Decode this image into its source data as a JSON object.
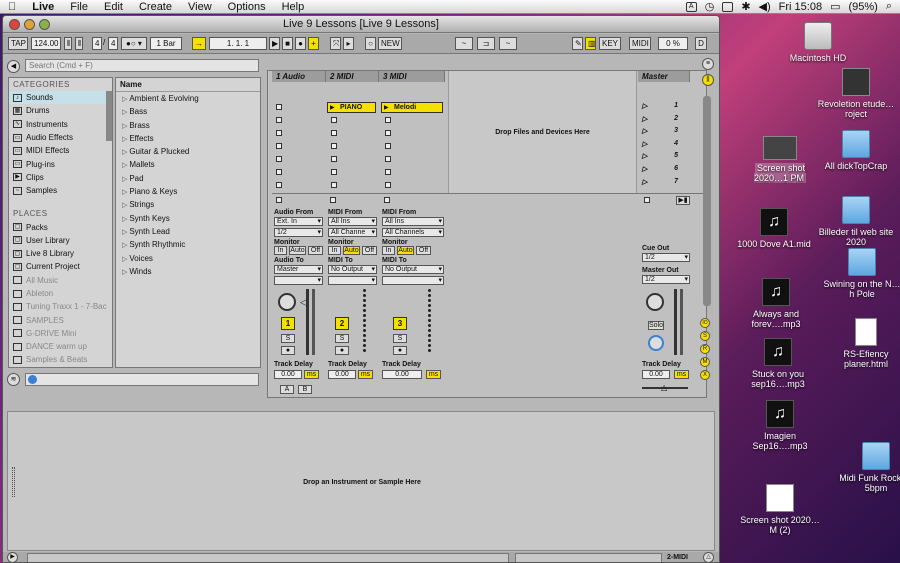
{
  "menubar": {
    "app": "Live",
    "items": [
      "File",
      "Edit",
      "Create",
      "View",
      "Options",
      "Help"
    ],
    "clock": "Fri 15:08",
    "battery": "(95%)"
  },
  "window": {
    "title": "Live 9 Lessons  [Live 9 Lessons]"
  },
  "control": {
    "tap": "TAP",
    "tempo": "124.00",
    "sig_num": "4",
    "sig_den": "4",
    "quant": "1 Bar",
    "position": "1.    1.    1",
    "new": "NEW",
    "key": "KEY",
    "midi": "MIDI",
    "cpu": "0 %",
    "d": "D"
  },
  "browser": {
    "search_placeholder": "Search (Cmd + F)",
    "categories_title": "CATEGORIES",
    "categories": [
      "Sounds",
      "Drums",
      "Instruments",
      "Audio Effects",
      "MIDI Effects",
      "Plug-ins",
      "Clips",
      "Samples"
    ],
    "places_title": "PLACES",
    "places": [
      "Packs",
      "User Library",
      "Live 8 Library",
      "Current Project",
      "All Music",
      "Ableton",
      "Tuning Traxx 1 - 7-Bac",
      "SAMPLES",
      "G-DRIVE Mini",
      "DANCE warm up",
      "Samples & Beats"
    ],
    "name_header": "Name",
    "names": [
      "Ambient & Evolving",
      "Bass",
      "Brass",
      "Effects",
      "Guitar & Plucked",
      "Mallets",
      "Pad",
      "Piano & Keys",
      "Strings",
      "Synth Keys",
      "Synth Lead",
      "Synth Rhythmic",
      "Voices",
      "Winds"
    ]
  },
  "session": {
    "tracks": [
      "1 Audio",
      "2 MIDI",
      "3 MIDI"
    ],
    "master": "Master",
    "clips": [
      "PIANO",
      "Melodi"
    ],
    "drop_text": "Drop Files and Devices Here",
    "scenes": [
      "1",
      "2",
      "3",
      "4",
      "5",
      "6",
      "7"
    ],
    "t1": {
      "from_label": "Audio From",
      "from": "Ext. In",
      "chan": "1/2",
      "to_label": "Audio To",
      "to": "Master",
      "num": "1"
    },
    "t2": {
      "from_label": "MIDI From",
      "from": "All Ins",
      "chan": "All Channe",
      "to_label": "MIDI To",
      "to": "No Output",
      "num": "2"
    },
    "t3": {
      "from_label": "MIDI From",
      "from": "All Ins",
      "chan": "All Channels",
      "to_label": "MIDI To",
      "to": "No Output",
      "num": "3"
    },
    "monitor": "Monitor",
    "in": "In",
    "auto": "Auto",
    "off": "Off",
    "s": "S",
    "track_delay": "Track Delay",
    "delay_val": "0.00",
    "ms": "ms",
    "cue_out": "Cue Out",
    "cue_val": "1/2",
    "master_out": "Master Out",
    "master_val": "1/2",
    "solo": "Solo",
    "a": "A",
    "b": "B"
  },
  "device": {
    "drop_text": "Drop an Instrument or Sample Here",
    "status_track": "2-MIDI"
  },
  "desktop": [
    {
      "label": "Macintosh HD",
      "kind": "drive"
    },
    {
      "label": "Revoletion etude…roject",
      "kind": "doc"
    },
    {
      "label": "Screen shot 2020…1 PM",
      "kind": "doc"
    },
    {
      "label": "All dickTopCrap",
      "kind": "folder"
    },
    {
      "label": "Billeder til web site 2020",
      "kind": "folder"
    },
    {
      "label": "1000 Dove A1.mid",
      "kind": "music"
    },
    {
      "label": "Swining on the N…h Pole",
      "kind": "folder"
    },
    {
      "label": "Always and forev….mp3",
      "kind": "music"
    },
    {
      "label": "RS-Efiency planer.html",
      "kind": "doc"
    },
    {
      "label": "Stuck on you sep16….mp3",
      "kind": "music"
    },
    {
      "label": "Imagien Sep16….mp3",
      "kind": "music"
    },
    {
      "label": "Midi Funk Rock …5bpm",
      "kind": "folder"
    },
    {
      "label": "Screen shot 2020…M (2)",
      "kind": "doc"
    }
  ]
}
